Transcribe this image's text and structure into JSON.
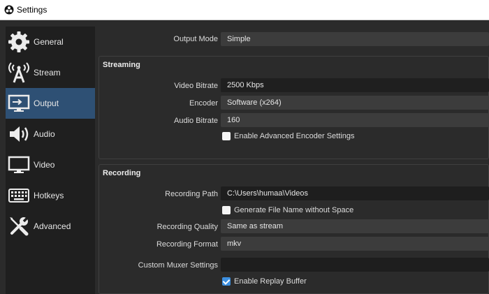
{
  "window": {
    "title": "Settings"
  },
  "sidebar": {
    "items": [
      {
        "label": "General",
        "icon": "gear-icon",
        "active": false
      },
      {
        "label": "Stream",
        "icon": "antenna-icon",
        "active": false
      },
      {
        "label": "Output",
        "icon": "monitor-output-icon",
        "active": true
      },
      {
        "label": "Audio",
        "icon": "speaker-icon",
        "active": false
      },
      {
        "label": "Video",
        "icon": "monitor-icon",
        "active": false
      },
      {
        "label": "Hotkeys",
        "icon": "keyboard-icon",
        "active": false
      },
      {
        "label": "Advanced",
        "icon": "wrench-screwdriver-icon",
        "active": false
      }
    ]
  },
  "output_mode": {
    "label": "Output Mode",
    "value": "Simple"
  },
  "streaming": {
    "title": "Streaming",
    "video_bitrate": {
      "label": "Video Bitrate",
      "value": "2500 Kbps"
    },
    "encoder": {
      "label": "Encoder",
      "value": "Software (x264)"
    },
    "audio_bitrate": {
      "label": "Audio Bitrate",
      "value": "160"
    },
    "advanced_encoder": {
      "label": "Enable Advanced Encoder Settings",
      "checked": false
    }
  },
  "recording": {
    "title": "Recording",
    "path": {
      "label": "Recording Path",
      "value": "C:\\Users\\humaa\\Videos"
    },
    "no_space": {
      "label": "Generate File Name without Space",
      "checked": false
    },
    "quality": {
      "label": "Recording Quality",
      "value": "Same as stream"
    },
    "format": {
      "label": "Recording Format",
      "value": "mkv"
    },
    "muxer": {
      "label": "Custom Muxer Settings",
      "value": ""
    },
    "replay_buffer": {
      "label": "Enable Replay Buffer",
      "checked": true
    }
  },
  "colors": {
    "active_nav": "#2e5074",
    "checkbox_on": "#3c8fe0",
    "panel": "#2b2b2b",
    "sidebar": "#1f1f1f"
  }
}
